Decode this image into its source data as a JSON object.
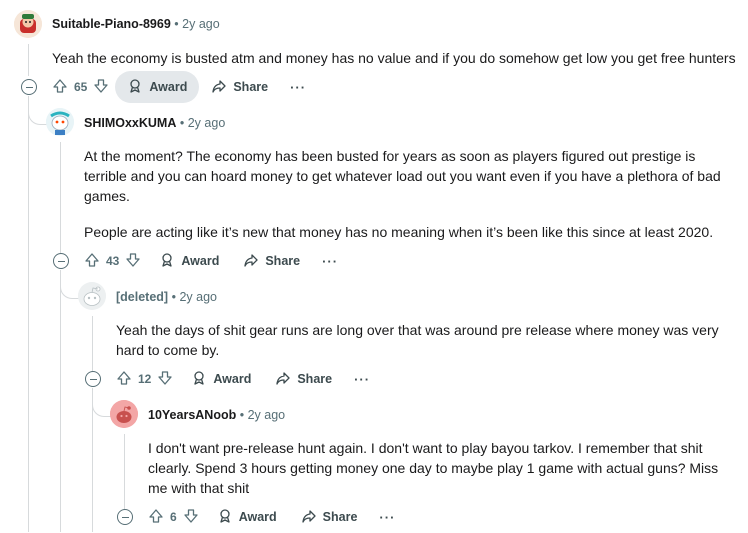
{
  "comments": [
    {
      "author": "Suitable-Piano-8969",
      "time": "2y ago",
      "body": [
        "Yeah the economy is busted atm and money has no value and if you do somehow get low you get free hunters"
      ],
      "votes": "65",
      "award_label": "Award",
      "share_label": "Share",
      "more_label": "···"
    },
    {
      "author": "SHIMOxxKUMA",
      "time": "2y ago",
      "body": [
        "At the moment? The economy has been busted for years as soon as players figured out prestige is terrible and you can hoard money to get whatever load out you want even if you have a plethora of bad games.",
        "People are acting like it’s new that money has no meaning when it’s been like this since at least 2020."
      ],
      "votes": "43",
      "award_label": "Award",
      "share_label": "Share",
      "more_label": "···"
    },
    {
      "author": "[deleted]",
      "time": "2y ago",
      "body": [
        "Yeah the days of shit gear runs are long over that was around pre release where money was very hard to come by."
      ],
      "votes": "12",
      "award_label": "Award",
      "share_label": "Share",
      "more_label": "···"
    },
    {
      "author": "10YearsANoob",
      "time": "2y ago",
      "body": [
        "I don't want pre-release hunt again. I don't want to play bayou tarkov. I remember that shit clearly. Spend 3 hours getting money one day to maybe play 1 game with actual guns? Miss me with that shit"
      ],
      "votes": "6",
      "award_label": "Award",
      "share_label": "Share",
      "more_label": "···"
    }
  ],
  "separator": "•",
  "colors": {
    "meta": "#576f76",
    "line": "#d7dadc",
    "active_button": "#e4e8eb"
  }
}
